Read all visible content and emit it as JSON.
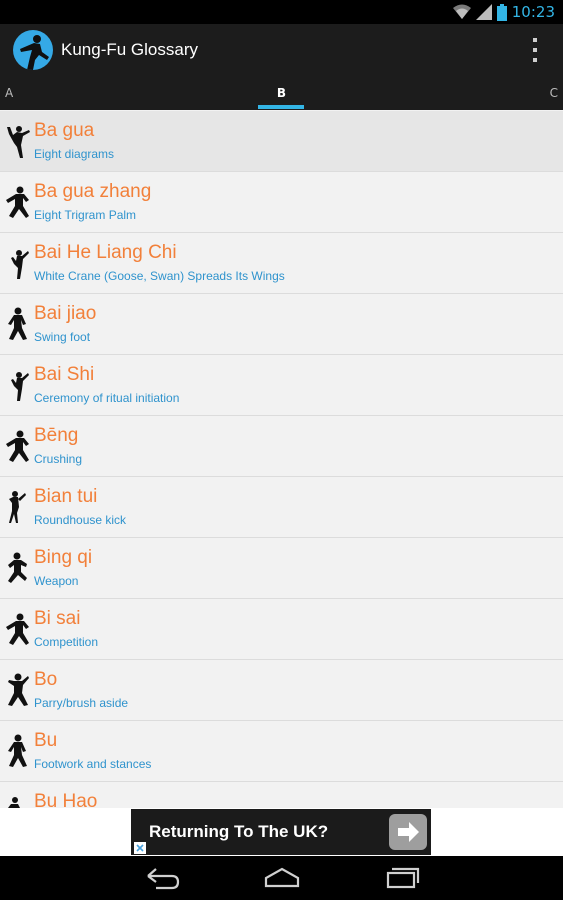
{
  "status_bar": {
    "time": "10:23",
    "icons": [
      "wifi-icon",
      "signal-icon",
      "battery-icon"
    ]
  },
  "action_bar": {
    "title": "Kung-Fu Glossary",
    "icons": [
      "app-logo-icon",
      "overflow-menu-icon"
    ]
  },
  "tabs": {
    "left": "A",
    "current": "B",
    "right": "C"
  },
  "entries": [
    {
      "title": "Ba gua",
      "subtitle": "Eight diagrams"
    },
    {
      "title": "Ba gua zhang",
      "subtitle": "Eight Trigram Palm"
    },
    {
      "title": "Bai He Liang Chi",
      "subtitle": "White Crane (Goose, Swan) Spreads Its Wings"
    },
    {
      "title": "Bai jiao",
      "subtitle": "Swing foot"
    },
    {
      "title": "Bai Shi",
      "subtitle": "Ceremony of ritual initiation"
    },
    {
      "title": "Bēng",
      "subtitle": "Crushing"
    },
    {
      "title": "Bian tui",
      "subtitle": "Roundhouse kick"
    },
    {
      "title": "Bing qi",
      "subtitle": "Weapon"
    },
    {
      "title": "Bi sai",
      "subtitle": "Competition"
    },
    {
      "title": "Bo",
      "subtitle": "Parry/brush aside"
    },
    {
      "title": "Bu",
      "subtitle": "Footwork and stances"
    },
    {
      "title": "Bu Hao",
      "subtitle": ""
    }
  ],
  "ad": {
    "text": "Returning To The UK?",
    "icons": [
      "arrow-right-icon",
      "ad-choices-icon"
    ]
  },
  "nav_bar": {
    "icons": [
      "back-icon",
      "home-icon",
      "recent-apps-icon"
    ]
  },
  "colors": {
    "title_orange": "#f2803a",
    "subtitle_blue": "#2f93cd",
    "accent": "#33b5e5",
    "action_bar": "#1c1c1c"
  }
}
